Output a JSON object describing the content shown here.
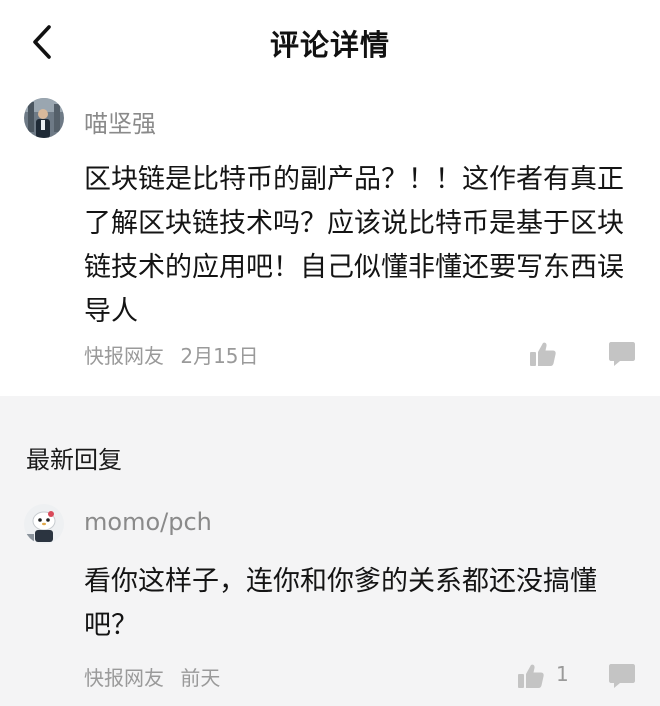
{
  "header": {
    "title": "评论详情",
    "back_icon": "chevron-left-icon"
  },
  "main_comment": {
    "username": "喵坚强",
    "text": "区块链是比特币的副产品？！！这作者有真正了解区块链技术吗？应该说比特币是基于区块链技术的应用吧！自己似懂非懂还要写东西误导人",
    "source": "快报网友",
    "date": "2月15日",
    "like_icon": "thumbs-up-icon",
    "reply_icon": "comment-icon"
  },
  "replies_section": {
    "title": "最新回复"
  },
  "reply": {
    "username": "momo/pch",
    "text": "看你这样子，连你和你爹的关系都还没搞懂吧？",
    "source": "快报网友",
    "date": "前天",
    "likes": "1",
    "like_icon": "thumbs-up-icon",
    "reply_icon": "comment-icon"
  },
  "colors": {
    "icon_gray": "#c4c4c4",
    "meta_gray": "#9a9a9a",
    "section_bg": "#f4f4f5"
  }
}
